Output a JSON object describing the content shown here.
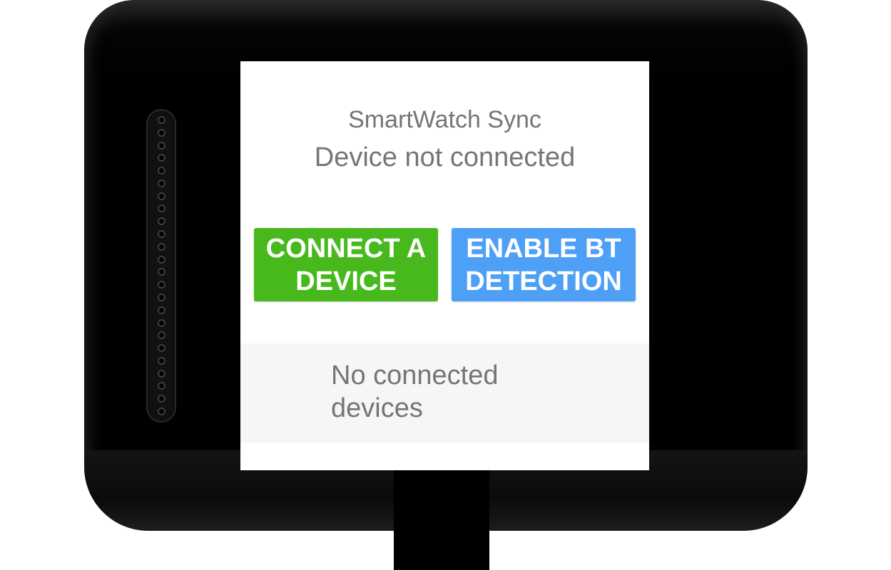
{
  "app": {
    "title": "SmartWatch Sync",
    "status": "Device not connected"
  },
  "actions": {
    "connect_label": "CONNECT A DEVICE",
    "enable_bt_label": "ENABLE BT DETECTION"
  },
  "devices": {
    "empty_message": "No connected devices"
  },
  "colors": {
    "connect_button": "#48b91c",
    "enable_bt_button": "#4ea0f7",
    "text_secondary": "#757575",
    "panel_background": "#f6f6f6",
    "watch_body": "#000000"
  }
}
